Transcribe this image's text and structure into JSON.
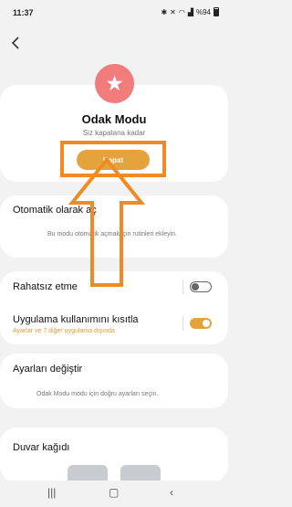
{
  "status": {
    "time": "11:37",
    "battery": "%94"
  },
  "header": {
    "back_icon": "chevron-left-icon"
  },
  "mode": {
    "icon": "star-icon",
    "icon_color": "#f27c7c",
    "title": "Odak Modu",
    "subtitle": "Siz kapatana kadar",
    "button_label": "Kapat",
    "accent": "#e4a33c"
  },
  "auto": {
    "title": "Otomatik olarak aç",
    "description": "Bu modu otomatik açmak için rutinleri ekleyin."
  },
  "toggles": [
    {
      "title": "Rahatsız etme",
      "subtitle": "",
      "on": false
    },
    {
      "title": "Uygulama kullanımını kısıtla",
      "subtitle": "Ayarlar ve 7 diğer uygulama dışında",
      "on": true
    }
  ],
  "settings": {
    "title": "Ayarları değiştir",
    "description": "Odak Modu modu için doğru ayarları seçin."
  },
  "wallpaper": {
    "title": "Duvar kağıdı"
  },
  "annotation": {
    "color": "#f08a24"
  }
}
